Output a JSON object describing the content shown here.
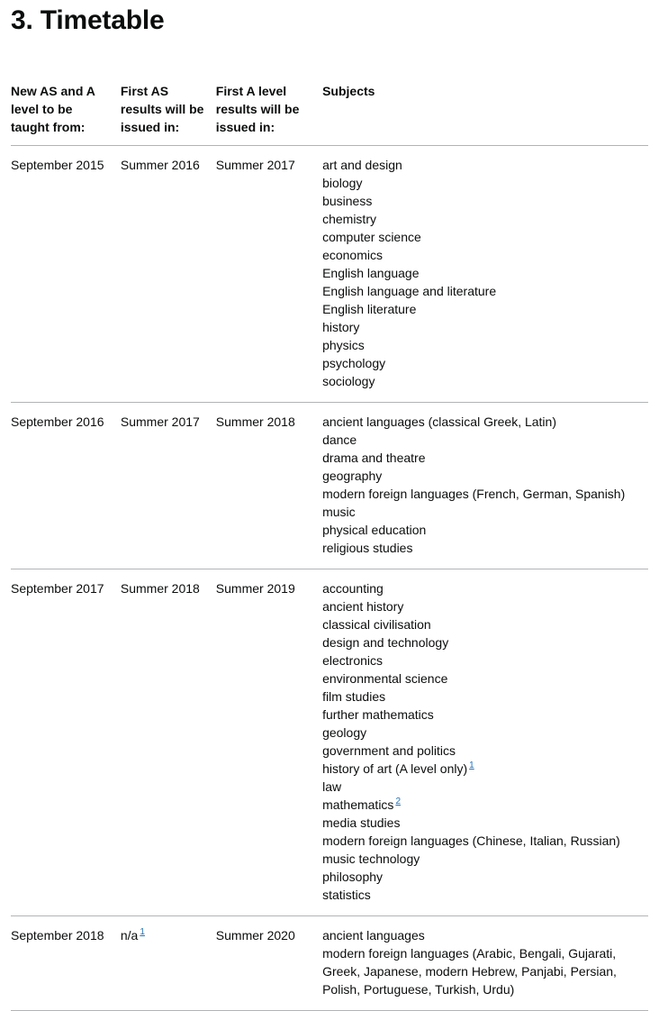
{
  "page": {
    "title": "3. Timetable"
  },
  "table": {
    "headers": [
      "New AS and A level to be taught from:",
      "First AS results will be issued in:",
      "First A level results will be issued in:",
      "Subjects"
    ],
    "rows": [
      {
        "taught_from": "September 2015",
        "first_as_results": "Summer 2016",
        "first_as_footnote": "",
        "first_a_results": "Summer 2017",
        "subjects": [
          {
            "text": "art and design",
            "footnote": ""
          },
          {
            "text": "biology",
            "footnote": ""
          },
          {
            "text": "business",
            "footnote": ""
          },
          {
            "text": "chemistry",
            "footnote": ""
          },
          {
            "text": "computer science",
            "footnote": ""
          },
          {
            "text": "economics",
            "footnote": ""
          },
          {
            "text": "English language",
            "footnote": ""
          },
          {
            "text": "English language and literature",
            "footnote": ""
          },
          {
            "text": "English literature",
            "footnote": ""
          },
          {
            "text": "history",
            "footnote": ""
          },
          {
            "text": "physics",
            "footnote": ""
          },
          {
            "text": "psychology",
            "footnote": ""
          },
          {
            "text": "sociology",
            "footnote": ""
          }
        ]
      },
      {
        "taught_from": "September 2016",
        "first_as_results": "Summer 2017",
        "first_as_footnote": "",
        "first_a_results": "Summer 2018",
        "subjects": [
          {
            "text": "ancient languages (classical Greek, Latin)",
            "footnote": ""
          },
          {
            "text": "dance",
            "footnote": ""
          },
          {
            "text": "drama and theatre",
            "footnote": ""
          },
          {
            "text": "geography",
            "footnote": ""
          },
          {
            "text": "modern foreign languages (French, German, Spanish)",
            "footnote": ""
          },
          {
            "text": "music",
            "footnote": ""
          },
          {
            "text": "physical education",
            "footnote": ""
          },
          {
            "text": "religious studies",
            "footnote": ""
          }
        ]
      },
      {
        "taught_from": "September 2017",
        "first_as_results": "Summer 2018",
        "first_as_footnote": "",
        "first_a_results": "Summer 2019",
        "subjects": [
          {
            "text": "accounting",
            "footnote": ""
          },
          {
            "text": "ancient history",
            "footnote": ""
          },
          {
            "text": "classical civilisation",
            "footnote": ""
          },
          {
            "text": "design and technology",
            "footnote": ""
          },
          {
            "text": "electronics",
            "footnote": ""
          },
          {
            "text": "environmental science",
            "footnote": ""
          },
          {
            "text": "film studies",
            "footnote": ""
          },
          {
            "text": "further mathematics",
            "footnote": ""
          },
          {
            "text": "geology",
            "footnote": ""
          },
          {
            "text": "government and politics",
            "footnote": ""
          },
          {
            "text": "history of art (A level only)",
            "footnote": "1"
          },
          {
            "text": "law",
            "footnote": ""
          },
          {
            "text": "mathematics",
            "footnote": "2"
          },
          {
            "text": "media studies",
            "footnote": ""
          },
          {
            "text": "modern foreign languages (Chinese, Italian, Russian)",
            "footnote": ""
          },
          {
            "text": "music technology",
            "footnote": ""
          },
          {
            "text": "philosophy",
            "footnote": ""
          },
          {
            "text": "statistics",
            "footnote": ""
          }
        ]
      },
      {
        "taught_from": "September 2018",
        "first_as_results": "n/a",
        "first_as_footnote": "1",
        "first_a_results": "Summer 2020",
        "subjects": [
          {
            "text": "ancient languages",
            "footnote": ""
          },
          {
            "text": "modern foreign languages (Arabic, Bengali, Gujarati, Greek, Japanese, modern Hebrew, Panjabi, Persian, Polish, Portuguese, Turkish, Urdu)",
            "footnote": ""
          }
        ]
      }
    ]
  },
  "colors": {
    "text": "#0b0c0c",
    "link": "#1d70b8",
    "rule": "#b1b4b6",
    "background": "#ffffff"
  }
}
